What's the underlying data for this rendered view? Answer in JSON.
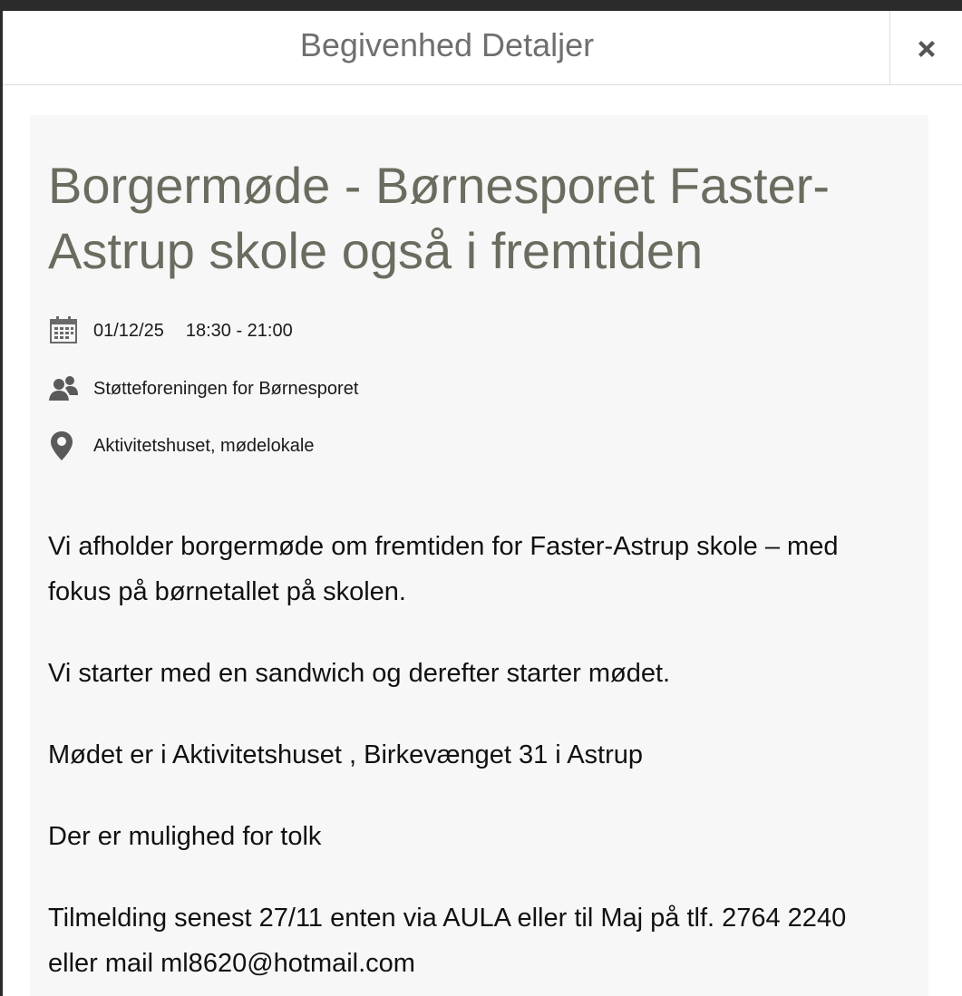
{
  "modal": {
    "title": "Begivenhed Detaljer",
    "close_icon": "close-icon"
  },
  "event": {
    "title": "Borgermøde - Børnesporet Faster-Astrup skole også i fremtiden",
    "date": "01/12/25",
    "time": "18:30 - 21:00",
    "organizer": "Støtteforeningen for Børnesporet",
    "location": "Aktivitetshuset, mødelokale",
    "description": [
      "Vi afholder borgermøde om fremtiden for Faster-Astrup skole – med fokus på børnetallet på skolen.",
      "Vi starter med en sandwich og derefter starter mødet.",
      "Mødet er i Aktivitetshuset , Birkevænget 31 i Astrup",
      "Der er mulighed for tolk",
      "Tilmelding senest 27/11 enten via AULA eller til Maj på tlf. 2764 2240 eller mail ml8620@hotmail.com"
    ]
  },
  "icons": {
    "date": "calendar-icon",
    "organizer": "people-icon",
    "location": "map-pin-icon"
  },
  "colors": {
    "title": "#6b6b5f",
    "panel": "#f7f7f7",
    "header_text": "#6f6f6f"
  }
}
